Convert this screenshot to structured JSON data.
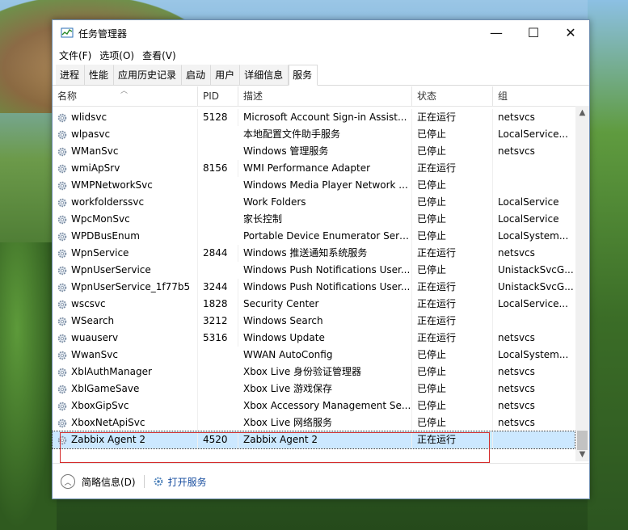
{
  "window": {
    "title": "任务管理器",
    "minimize": "—",
    "maximize": "☐",
    "close": "✕"
  },
  "menu": [
    "文件(F)",
    "选项(O)",
    "查看(V)"
  ],
  "tabs": [
    "进程",
    "性能",
    "应用历史记录",
    "启动",
    "用户",
    "详细信息",
    "服务"
  ],
  "active_tab": "服务",
  "columns": {
    "name": "名称",
    "pid": "PID",
    "desc": "描述",
    "status": "状态",
    "group": "组"
  },
  "rows": [
    {
      "name": "wlidsvc",
      "pid": "5128",
      "desc": "Microsoft Account Sign-in Assist...",
      "status": "正在运行",
      "group": "netsvcs"
    },
    {
      "name": "wlpasvc",
      "pid": "",
      "desc": "本地配置文件助手服务",
      "status": "已停止",
      "group": "LocalService..."
    },
    {
      "name": "WManSvc",
      "pid": "",
      "desc": "Windows 管理服务",
      "status": "已停止",
      "group": "netsvcs"
    },
    {
      "name": "wmiApSrv",
      "pid": "8156",
      "desc": "WMI Performance Adapter",
      "status": "正在运行",
      "group": ""
    },
    {
      "name": "WMPNetworkSvc",
      "pid": "",
      "desc": "Windows Media Player Network ...",
      "status": "已停止",
      "group": ""
    },
    {
      "name": "workfolderssvc",
      "pid": "",
      "desc": "Work Folders",
      "status": "已停止",
      "group": "LocalService"
    },
    {
      "name": "WpcMonSvc",
      "pid": "",
      "desc": "家长控制",
      "status": "已停止",
      "group": "LocalService"
    },
    {
      "name": "WPDBusEnum",
      "pid": "",
      "desc": "Portable Device Enumerator Serv...",
      "status": "已停止",
      "group": "LocalSystem..."
    },
    {
      "name": "WpnService",
      "pid": "2844",
      "desc": "Windows 推送通知系统服务",
      "status": "正在运行",
      "group": "netsvcs"
    },
    {
      "name": "WpnUserService",
      "pid": "",
      "desc": "Windows Push Notifications User...",
      "status": "已停止",
      "group": "UnistackSvcG..."
    },
    {
      "name": "WpnUserService_1f77b5",
      "pid": "3244",
      "desc": "Windows Push Notifications User...",
      "status": "正在运行",
      "group": "UnistackSvcG..."
    },
    {
      "name": "wscsvc",
      "pid": "1828",
      "desc": "Security Center",
      "status": "正在运行",
      "group": "LocalService..."
    },
    {
      "name": "WSearch",
      "pid": "3212",
      "desc": "Windows Search",
      "status": "正在运行",
      "group": ""
    },
    {
      "name": "wuauserv",
      "pid": "5316",
      "desc": "Windows Update",
      "status": "正在运行",
      "group": "netsvcs"
    },
    {
      "name": "WwanSvc",
      "pid": "",
      "desc": "WWAN AutoConfig",
      "status": "已停止",
      "group": "LocalSystem..."
    },
    {
      "name": "XblAuthManager",
      "pid": "",
      "desc": "Xbox Live 身份验证管理器",
      "status": "已停止",
      "group": "netsvcs"
    },
    {
      "name": "XblGameSave",
      "pid": "",
      "desc": "Xbox Live 游戏保存",
      "status": "已停止",
      "group": "netsvcs"
    },
    {
      "name": "XboxGipSvc",
      "pid": "",
      "desc": "Xbox Accessory Management Se...",
      "status": "已停止",
      "group": "netsvcs"
    },
    {
      "name": "XboxNetApiSvc",
      "pid": "",
      "desc": "Xbox Live 网络服务",
      "status": "已停止",
      "group": "netsvcs"
    },
    {
      "name": "Zabbix Agent 2",
      "pid": "4520",
      "desc": "Zabbix Agent 2",
      "status": "正在运行",
      "group": ""
    }
  ],
  "selected_row": "Zabbix Agent 2",
  "footer": {
    "brief": "简略信息(D)",
    "open_services": "打开服务"
  }
}
